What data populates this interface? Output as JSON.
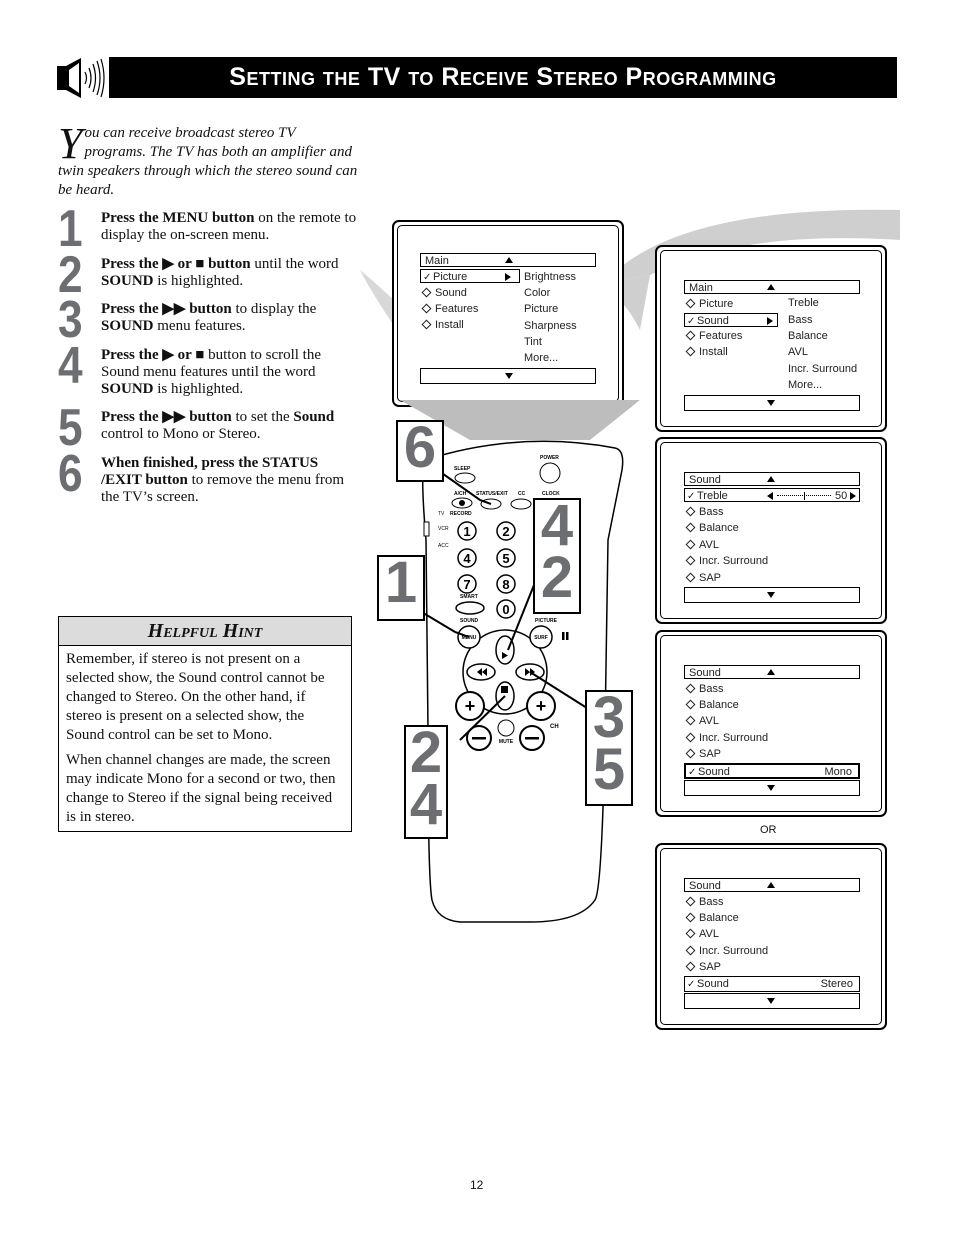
{
  "header": {
    "icon": "speaker-icon",
    "title": "Setting the TV to Receive Stereo Programming"
  },
  "intro": {
    "dropcap": "Y",
    "text": "ou can receive broadcast stereo TV programs. The TV has both an amplifier and twin speakers through which the stereo sound can be heard."
  },
  "steps": [
    {
      "num": "1",
      "bold": "Press the MENU button",
      "rest": " on the remote to display the on-screen menu."
    },
    {
      "num": "2",
      "bold1": "Press the ▶ or ■ button",
      "rest1": " until the word ",
      "bold2": "SOUND",
      "rest2": " is highlighted."
    },
    {
      "num": "3",
      "bold1": "Press the ▶▶ button",
      "rest1": " to display the ",
      "bold2": "SOUND",
      "rest2": " menu features."
    },
    {
      "num": "4",
      "bold1": "Press the ▶ or ■",
      "rest1": " button to scroll the Sound menu features until the word ",
      "bold2": "SOUND",
      "rest2": " is highlighted."
    },
    {
      "num": "5",
      "bold1": "Press the ▶▶ button",
      "rest1": " to set the ",
      "bold2": "Sound",
      "rest2": " control to Mono or Stereo."
    },
    {
      "num": "6",
      "bold": "When finished, press the STATUS /EXIT button",
      "rest": " to remove the menu from the TV’s screen."
    }
  ],
  "hint": {
    "title": "Helpful Hint",
    "paragraphs": [
      "Remember, if stereo is not present on a selected show, the Sound control cannot be changed to Stereo. On the other hand, if stereo is present on a selected show, the Sound control can be set to Mono.",
      "When channel changes are made, the screen may indicate Mono for a second or two, then change to Stereo if the signal being received is in stereo."
    ]
  },
  "screens": {
    "main_picture": {
      "header": "Main",
      "items": [
        "Picture",
        "Sound",
        "Features",
        "Install"
      ],
      "selected": "Picture",
      "submenu": [
        "Brightness",
        "Color",
        "Picture",
        "Sharpness",
        "Tint",
        "More..."
      ]
    },
    "main_sound": {
      "header": "Main",
      "items": [
        "Picture",
        "Sound",
        "Features",
        "Install"
      ],
      "selected": "Sound",
      "submenu": [
        "Treble",
        "Bass",
        "Balance",
        "AVL",
        "Incr. Surround",
        "More..."
      ]
    },
    "sound_treble": {
      "header": "Sound",
      "selected": "Treble",
      "slider_value": "50",
      "slider_fraction": 0.5,
      "items": [
        "Bass",
        "Balance",
        "AVL",
        "Incr. Surround",
        "SAP"
      ]
    },
    "sound_mono": {
      "header": "Sound",
      "items": [
        "Bass",
        "Balance",
        "AVL",
        "Incr. Surround",
        "SAP"
      ],
      "selected": "Sound",
      "value": "Mono"
    },
    "sound_stereo": {
      "header": "Sound",
      "items": [
        "Bass",
        "Balance",
        "AVL",
        "Incr. Surround",
        "SAP"
      ],
      "selected": "Sound",
      "value": "Stereo"
    },
    "or_label": "OR"
  },
  "remote": {
    "labels": {
      "sleep": "SLEEP",
      "power": "POWER",
      "av": "A/CH",
      "status_exit": "STATUS/EXIT",
      "cc": "CC",
      "clock": "CLOCK",
      "record": "RECORD",
      "tv": "TV",
      "vcr": "VCR",
      "acc": "ACC",
      "smart": "SMART",
      "sound": "SOUND",
      "picture": "PICTURE",
      "menu": "MENU",
      "surf": "SURF",
      "mute": "MUTE",
      "ch": "CH"
    },
    "digits": [
      "1",
      "2",
      "4",
      "5",
      "7",
      "8",
      "0"
    ],
    "callouts": [
      "6",
      "1",
      "4",
      "2",
      "2",
      "4",
      "3",
      "5"
    ]
  },
  "page_number": "12"
}
